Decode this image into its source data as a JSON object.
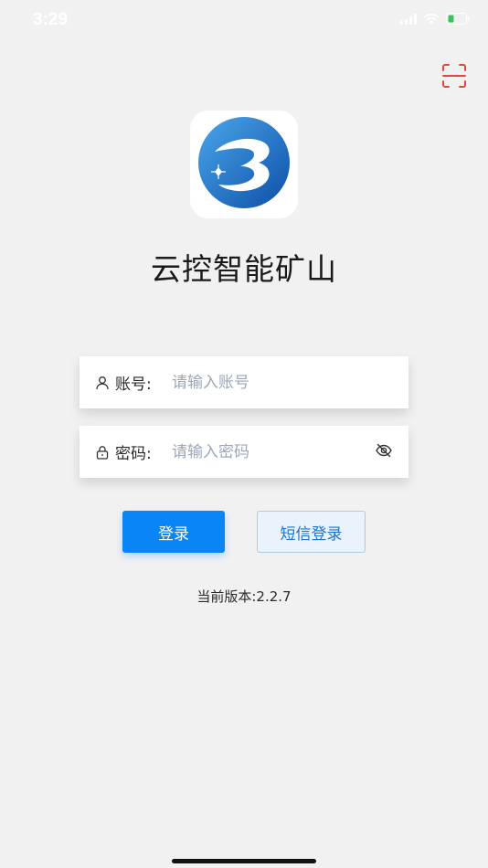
{
  "status_bar": {
    "time": "3:29"
  },
  "header": {
    "scan_icon": "scan-icon",
    "scan_color": "#e8463c"
  },
  "app": {
    "title": "云控智能矿山",
    "logo_icon": "app-logo-icon",
    "brand_color": "#1670c9"
  },
  "login_form": {
    "account": {
      "label": "账号:",
      "placeholder": "请输入账号",
      "value": "",
      "icon": "user-icon"
    },
    "password": {
      "label": "密码:",
      "placeholder": "请输入密码",
      "value": "",
      "icon": "lock-icon",
      "toggle_icon": "eye-off-icon"
    }
  },
  "actions": {
    "login_label": "登录",
    "sms_login_label": "短信登录",
    "primary_color": "#0a85f5"
  },
  "footer": {
    "version": "当前版本:2.2.7"
  }
}
